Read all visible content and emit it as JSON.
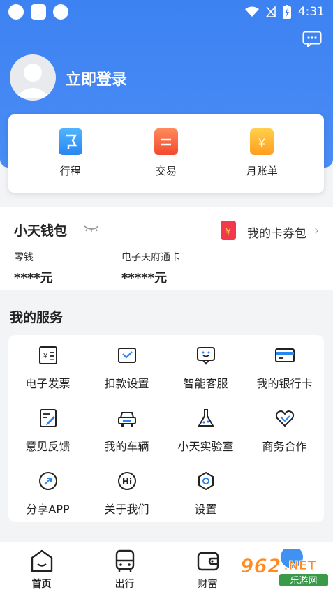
{
  "status_bar": {
    "time": "4:31"
  },
  "header": {
    "login_label": "立即登录"
  },
  "quick_actions": [
    {
      "label": "行程",
      "icon": "trip-icon",
      "color": "#2a86f0"
    },
    {
      "label": "交易",
      "icon": "trade-icon",
      "color": "#f24a2e"
    },
    {
      "label": "月账单",
      "icon": "bill-icon",
      "color": "#ff9d1f"
    }
  ],
  "wallet": {
    "title": "小天钱包",
    "coupon_label": "我的卡券包",
    "balances": [
      {
        "label": "零钱",
        "value": "****元"
      },
      {
        "label": "电子天府通卡",
        "value": "*****元"
      }
    ]
  },
  "services": {
    "title": "我的服务",
    "items": [
      {
        "label": "电子发票",
        "icon": "invoice-icon"
      },
      {
        "label": "扣款设置",
        "icon": "payment-settings-icon"
      },
      {
        "label": "智能客服",
        "icon": "customer-service-icon"
      },
      {
        "label": "我的银行卡",
        "icon": "bank-card-icon"
      },
      {
        "label": "意见反馈",
        "icon": "feedback-icon"
      },
      {
        "label": "我的车辆",
        "icon": "vehicle-icon"
      },
      {
        "label": "小天实验室",
        "icon": "lab-icon"
      },
      {
        "label": "商务合作",
        "icon": "cooperation-icon"
      },
      {
        "label": "分享APP",
        "icon": "share-icon"
      },
      {
        "label": "关于我们",
        "icon": "about-icon"
      },
      {
        "label": "设置",
        "icon": "settings-icon"
      }
    ]
  },
  "tabbar": {
    "items": [
      {
        "label": "首页",
        "icon": "home-icon",
        "active": true
      },
      {
        "label": "出行",
        "icon": "bus-icon",
        "active": false
      },
      {
        "label": "财富",
        "icon": "wallet-icon",
        "active": false
      }
    ]
  },
  "watermark": {
    "text": "962.NET",
    "subtext": "乐游网"
  },
  "colors": {
    "header_blue": "#3d82f2",
    "accent": "#2a86f0"
  }
}
